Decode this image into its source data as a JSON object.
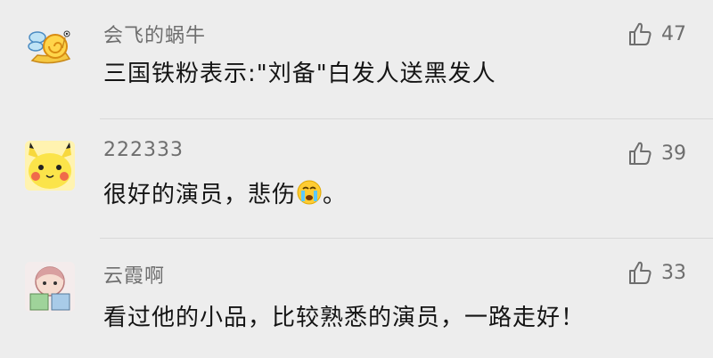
{
  "comments": [
    {
      "avatar_icon": "snail-icon",
      "username": "会飞的蜗牛",
      "text": "三国铁粉表示:\"刘备\"白发人送黑发人",
      "likes": "47"
    },
    {
      "avatar_icon": "pikachu-icon",
      "username": "222333",
      "text_before": "很好的演员，悲伤",
      "emoji_icon": "crying-face-icon",
      "text_after": "。",
      "likes": "39"
    },
    {
      "avatar_icon": "cartoon-girl-icon",
      "username": "云霞啊",
      "text": "看过他的小品，比较熟悉的演员，一路走好！",
      "likes": "33"
    }
  ],
  "colors": {
    "background": "#ededed",
    "username": "#6e6e6e",
    "text": "#141414",
    "like": "#6e6e6e"
  }
}
